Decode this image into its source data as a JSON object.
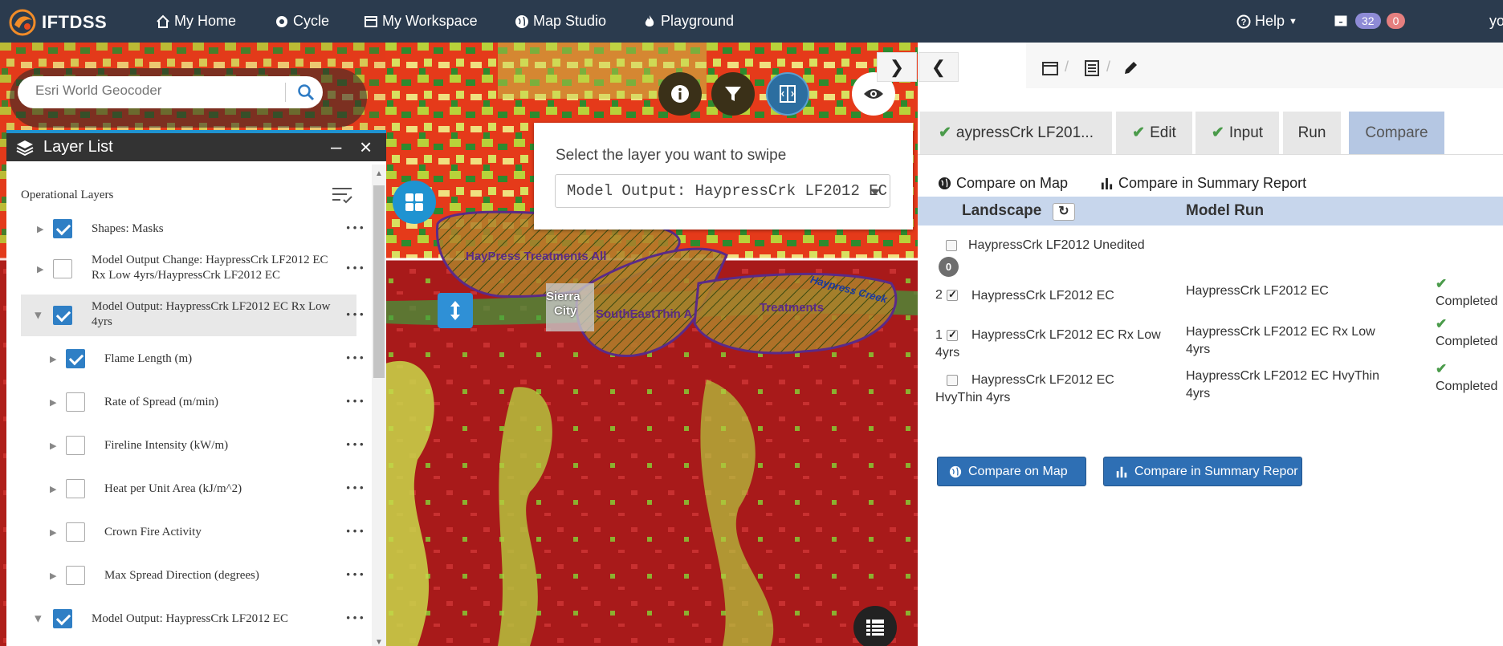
{
  "nav": {
    "brand": "IFTDSS",
    "home": "My Home",
    "cycle": "Cycle",
    "workspace": "My Workspace",
    "mapstudio": "Map Studio",
    "playground": "Playground",
    "help": "Help",
    "notif_count": "32",
    "alert_count": "0",
    "user_initial": "yo"
  },
  "map": {
    "search_placeholder": "Esri World Geocoder",
    "labels": {
      "treatments_all": "HayPress Treatments All",
      "sierra": "Sierra",
      "city": "City",
      "southeast": "SouthEastThin A",
      "treatments": "Treatments",
      "creek": "Haypress Creek"
    },
    "swipe": {
      "prompt": "Select the layer you want to swipe",
      "selected": "Model Output: HaypressCrk LF2012 EC"
    }
  },
  "layer_list": {
    "title": "Layer List",
    "section": "Operational Layers",
    "rows": [
      {
        "label": "Shapes: Masks",
        "checked": true
      },
      {
        "label": "Model Output Change: HaypressCrk LF2012 EC Rx Low 4yrs/HaypressCrk LF2012 EC",
        "checked": false
      },
      {
        "label": "Model Output: HaypressCrk LF2012 EC Rx Low 4yrs",
        "checked": true
      },
      {
        "label": "Flame Length (m)",
        "checked": true
      },
      {
        "label": "Rate of Spread (m/min)",
        "checked": false
      },
      {
        "label": "Fireline Intensity (kW/m)",
        "checked": false
      },
      {
        "label": "Heat per Unit Area (kJ/m^2)",
        "checked": false
      },
      {
        "label": "Crown Fire Activity",
        "checked": false
      },
      {
        "label": "Max Spread Direction (degrees)",
        "checked": false
      },
      {
        "label": "Model Output: HaypressCrk LF2012 EC",
        "checked": true
      }
    ]
  },
  "panel": {
    "tabs": [
      {
        "label": "aypressCrk LF201...",
        "check": true
      },
      {
        "label": "Edit",
        "check": true
      },
      {
        "label": "Input",
        "check": true
      },
      {
        "label": "Run",
        "check": false
      },
      {
        "label": "Compare",
        "check": false
      }
    ],
    "compare_map_link": "Compare on Map",
    "compare_report_link": "Compare in Summary Report",
    "col_landscape": "Landscape",
    "col_model_run": "Model Run",
    "zero_badge": "0",
    "rows": [
      {
        "num": "",
        "checked": false,
        "landscape": "HaypressCrk LF2012 Unedited",
        "run": "",
        "status": ""
      },
      {
        "num": "2",
        "checked": true,
        "landscape": "HaypressCrk LF2012 EC",
        "run": "HaypressCrk LF2012 EC",
        "status": "Completed"
      },
      {
        "num": "1",
        "checked": true,
        "landscape": "HaypressCrk LF2012 EC Rx Low 4yrs",
        "run": "HaypressCrk LF2012 EC Rx Low 4yrs",
        "status": "Completed"
      },
      {
        "num": "",
        "checked": false,
        "landscape": "HaypressCrk LF2012 EC HvyThin 4yrs",
        "run": "HaypressCrk LF2012 EC HvyThin 4yrs",
        "status": "Completed"
      }
    ],
    "btn_compare_map": "Compare on Map",
    "btn_compare_report": "Compare in Summary Repor"
  },
  "colors": {
    "nav_bg": "#2b3b4e",
    "accent": "#2e6fb4",
    "header_row": "#c7d6ec",
    "active_tab": "#b5c7e3",
    "check_green": "#4a9b4a"
  }
}
